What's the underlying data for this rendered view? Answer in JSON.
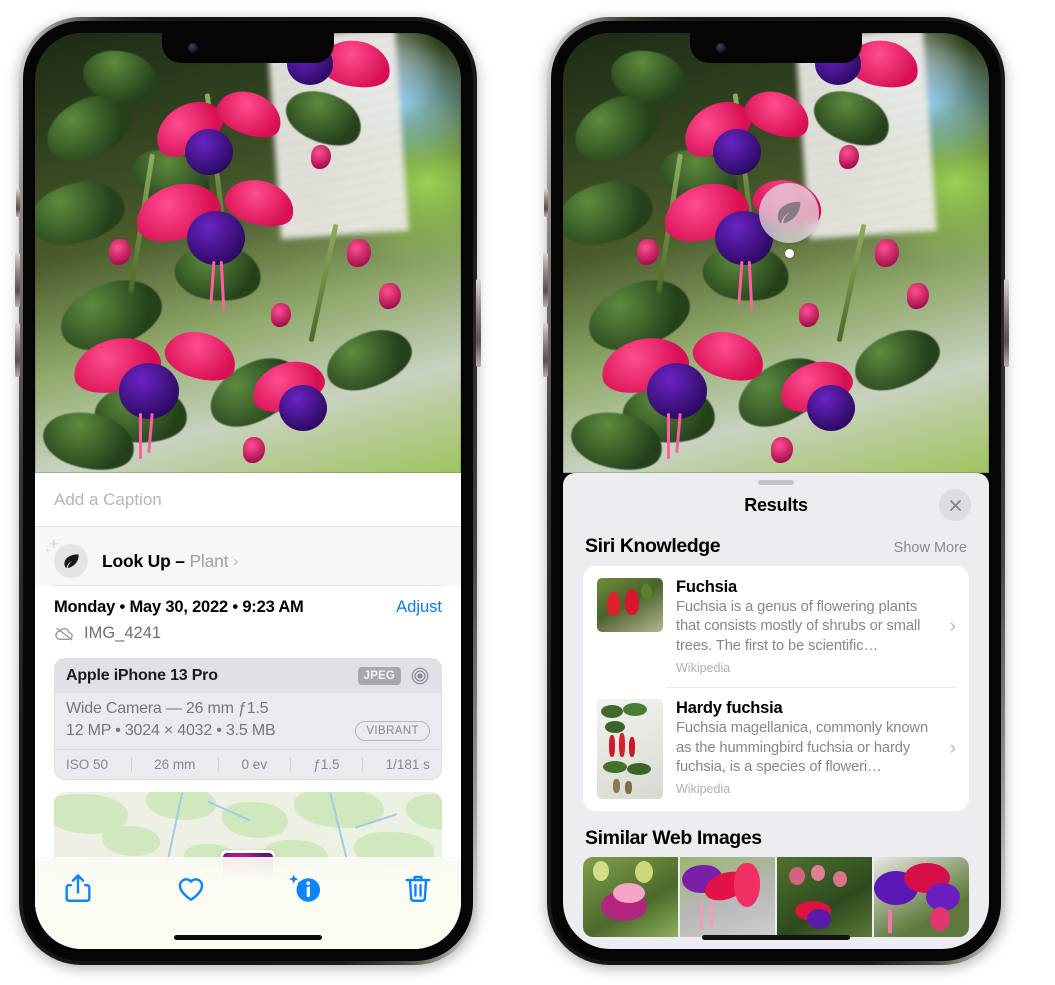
{
  "left_phone": {
    "caption": {
      "placeholder": "Add a Caption",
      "value": ""
    },
    "lookup": {
      "label": "Look Up",
      "separator": " – ",
      "subject": "Plant",
      "icon": "leaf-icon",
      "sparkle_icon": "sparkles-icon",
      "chevron": "›"
    },
    "metadata": {
      "date_line": "Monday • May 30, 2022 • 9:23 AM",
      "adjust_label": "Adjust",
      "cloud_icon": "icloud-slash-icon",
      "filename": "IMG_4241"
    },
    "camera_card": {
      "device": "Apple iPhone 13 Pro",
      "format_badge": "JPEG",
      "aperture_icon": "aperture-icon",
      "lens_line": "Wide Camera — 26 mm ƒ1.5",
      "specs_line": "12 MP • 3024 × 4032 • 3.5 MB",
      "style_badge": "VIBRANT",
      "exif": [
        "ISO 50",
        "26 mm",
        "0 ev",
        "ƒ1.5",
        "1/181 s"
      ]
    },
    "toolbar": [
      {
        "name": "share-icon",
        "label": "Share"
      },
      {
        "name": "heart-icon",
        "label": "Favorite"
      },
      {
        "name": "info-sparkle-icon",
        "label": "Info"
      },
      {
        "name": "trash-icon",
        "label": "Delete"
      }
    ]
  },
  "right_phone": {
    "visual_lookup_badge": {
      "icon": "leaf-icon"
    },
    "panel": {
      "title": "Results",
      "close_icon": "close-icon",
      "grabber": "drag-handle"
    },
    "siri_knowledge": {
      "section_title": "Siri Knowledge",
      "show_more_label": "Show More",
      "items": [
        {
          "title": "Fuchsia",
          "description": "Fuchsia is a genus of flowering plants that consists mostly of shrubs or small trees. The first to be scientific…",
          "source": "Wikipedia",
          "chevron": "›"
        },
        {
          "title": "Hardy fuchsia",
          "description": "Fuchsia magellanica, commonly known as the hummingbird fuchsia or hardy fuchsia, is a species of floweri…",
          "source": "Wikipedia",
          "chevron": "›"
        }
      ]
    },
    "similar_web_images": {
      "section_title": "Similar Web Images",
      "count": 4
    }
  },
  "colors": {
    "accent_blue": "#067cf9",
    "panel_bg": "#edecf1",
    "card_bg": "#ffffff",
    "muted_text": "#86858d",
    "badge_gray": "#a9a7ae"
  }
}
